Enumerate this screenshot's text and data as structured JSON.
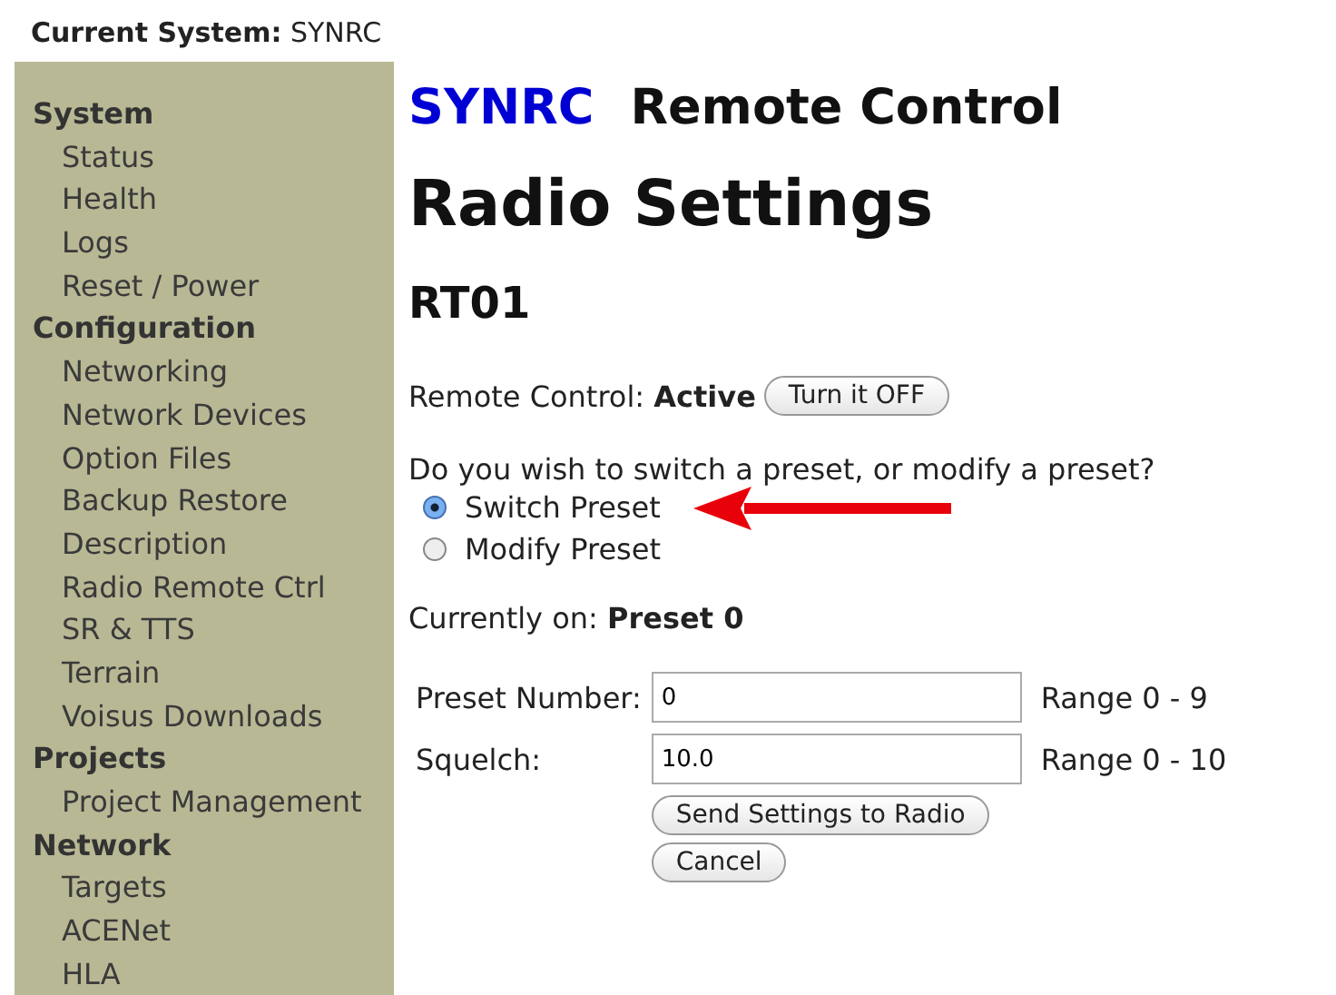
{
  "header": {
    "label": "Current System:",
    "value": "SYNRC"
  },
  "sidebar": [
    {
      "label": "System",
      "children": [
        {
          "label": "Status"
        },
        {
          "label": "Health"
        },
        {
          "label": "Logs"
        },
        {
          "label": "Reset / Power"
        }
      ]
    },
    {
      "label": "Configuration",
      "children": [
        {
          "label": "Networking"
        },
        {
          "label": "Network Devices"
        },
        {
          "label": "Option Files"
        },
        {
          "label": "Backup Restore"
        },
        {
          "label": "Description"
        },
        {
          "label": "Radio Remote Ctrl"
        },
        {
          "label": "SR & TTS"
        },
        {
          "label": "Terrain"
        },
        {
          "label": "Voisus Downloads"
        }
      ]
    },
    {
      "label": "Projects",
      "children": [
        {
          "label": "Project Management"
        }
      ]
    },
    {
      "label": "Network",
      "children": [
        {
          "label": "Targets"
        },
        {
          "label": "ACENet"
        },
        {
          "label": "HLA"
        }
      ]
    }
  ],
  "title": {
    "brand": "SYNRC",
    "text": "Remote Control"
  },
  "page_title": "Radio Settings",
  "device": "RT01",
  "remote_control": {
    "label": "Remote Control:",
    "value": "Active",
    "button": "Turn it OFF"
  },
  "question": "Do you wish to switch a preset, or modify a preset?",
  "radios": [
    {
      "label": "Switch Preset",
      "selected": true
    },
    {
      "label": "Modify Preset",
      "selected": false
    }
  ],
  "current": {
    "label": "Currently on:",
    "value": "Preset 0"
  },
  "fields": [
    {
      "label": "Preset Number:",
      "value": "0",
      "range": "Range 0 - 9"
    },
    {
      "label": "Squelch:",
      "value": "10.0",
      "range": "Range 0 - 10"
    }
  ],
  "buttons": [
    "Send Settings to Radio",
    "Cancel"
  ]
}
